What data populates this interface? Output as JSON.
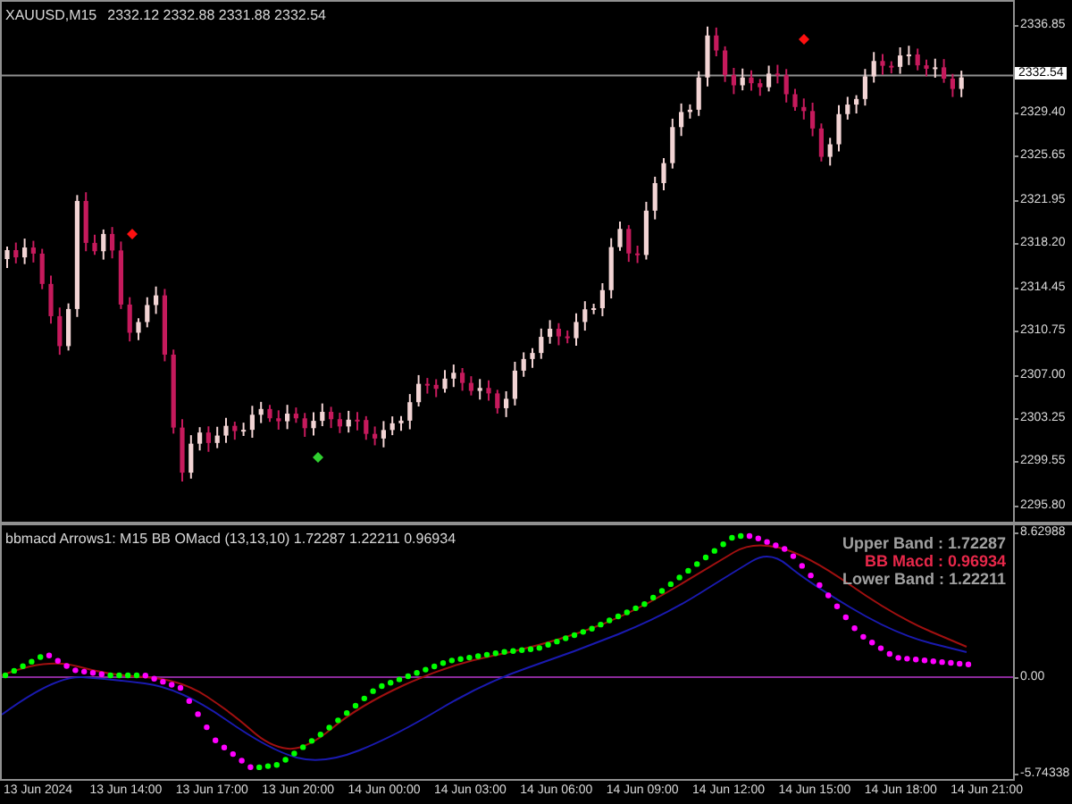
{
  "main_chart": {
    "symbol": "XAUUSD,M15",
    "ohlc": "2332.12 2332.88 2331.88 2332.54",
    "current_price": "2332.54",
    "price_axis": [
      "2336.85",
      "2329.40",
      "2325.65",
      "2321.95",
      "2318.20",
      "2314.45",
      "2310.75",
      "2307.00",
      "2303.25",
      "2299.55",
      "2295.80"
    ]
  },
  "indicator": {
    "title": "bbmacd Arrows1: M15 BB OMacd (13,13,10) 1.72287 1.22211 0.96934",
    "legend": [
      {
        "label": "Upper Band : 1.72287",
        "color": "#a0a0a0"
      },
      {
        "label": "BB Macd : 0.96934",
        "color": "#e8284a"
      },
      {
        "label": "Lower Band : 1.22211",
        "color": "#a0a0a0"
      }
    ],
    "value_axis": [
      "8.62988",
      "0.00",
      "-5.74338"
    ]
  },
  "time_axis": [
    "13 Jun 2024",
    "13 Jun 14:00",
    "13 Jun 17:00",
    "13 Jun 20:00",
    "14 Jun 00:00",
    "14 Jun 03:00",
    "14 Jun 06:00",
    "14 Jun 09:00",
    "14 Jun 12:00",
    "14 Jun 15:00",
    "14 Jun 18:00",
    "14 Jun 21:00"
  ]
}
